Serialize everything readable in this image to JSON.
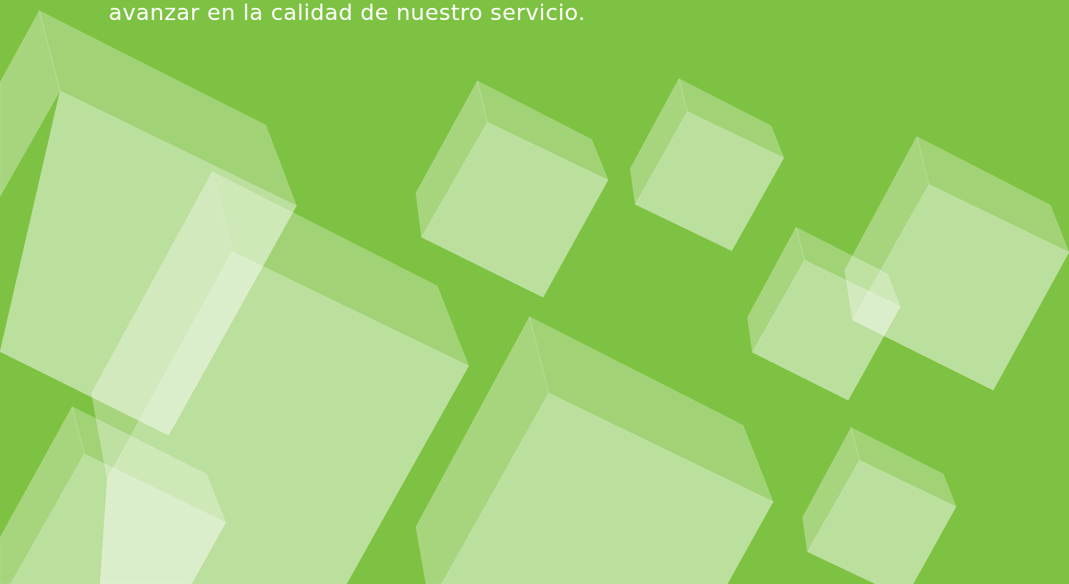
{
  "page": {
    "text": "avanzar en la calidad de nuestro servicio."
  }
}
